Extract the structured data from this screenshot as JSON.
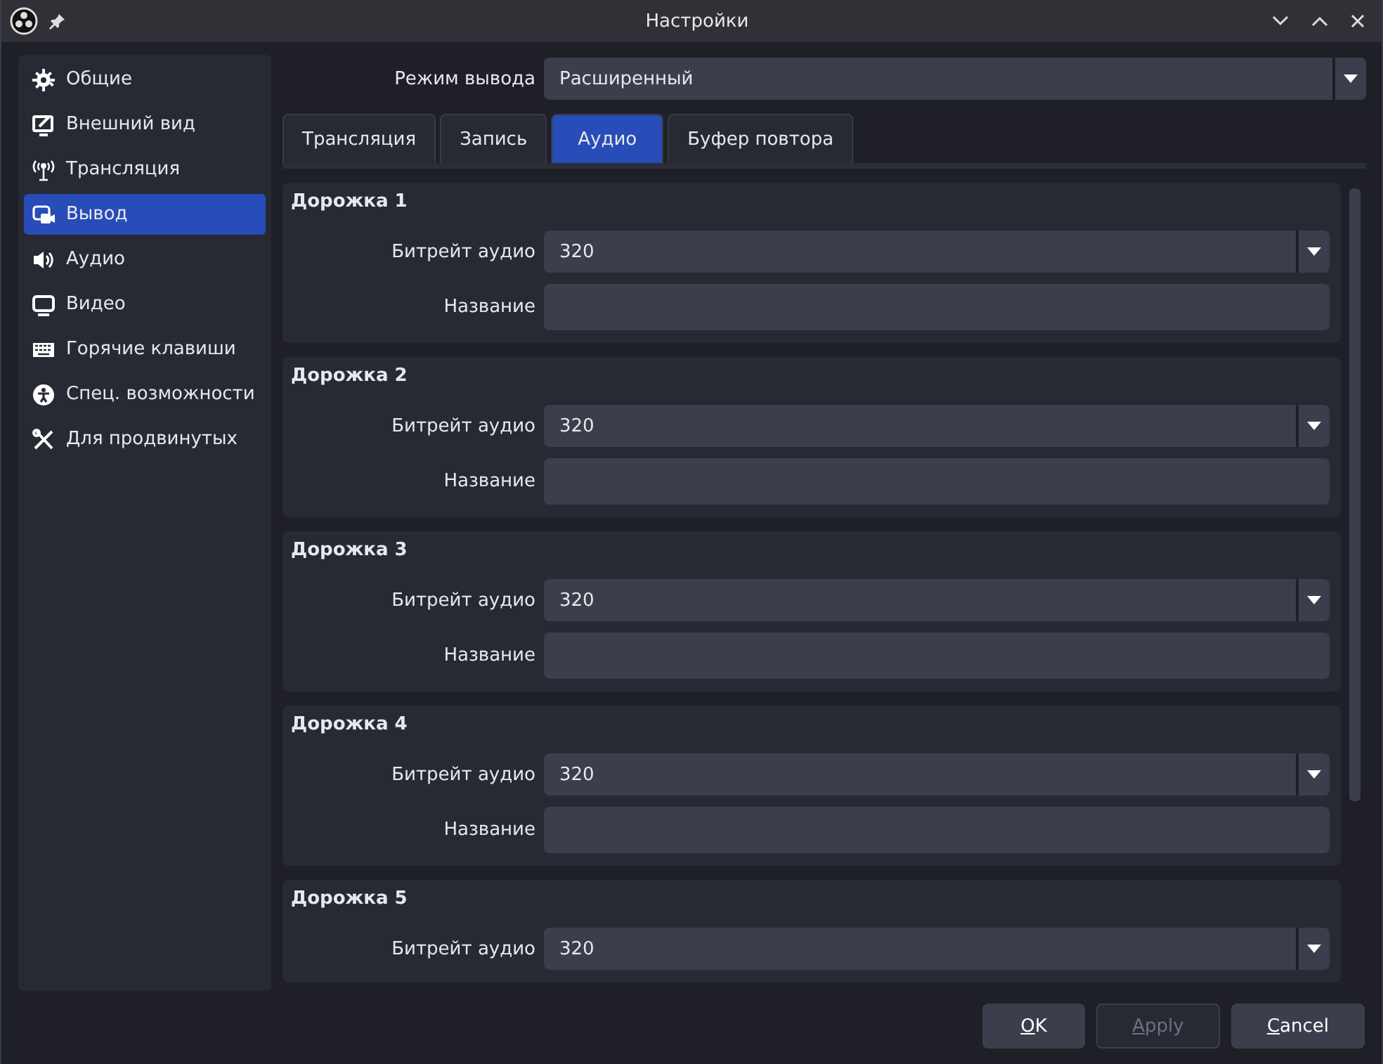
{
  "window": {
    "title": "Настройки"
  },
  "sidebar": {
    "items": [
      {
        "label": "Общие",
        "selected": false
      },
      {
        "label": "Внешний вид",
        "selected": false
      },
      {
        "label": "Трансляция",
        "selected": false
      },
      {
        "label": "Вывод",
        "selected": true
      },
      {
        "label": "Аудио",
        "selected": false
      },
      {
        "label": "Видео",
        "selected": false
      },
      {
        "label": "Горячие клавиши",
        "selected": false
      },
      {
        "label": "Спец. возможности",
        "selected": false
      },
      {
        "label": "Для продвинутых",
        "selected": false
      }
    ]
  },
  "output_mode": {
    "label": "Режим вывода",
    "value": "Расширенный"
  },
  "tabs": [
    {
      "label": "Трансляция",
      "selected": false
    },
    {
      "label": "Запись",
      "selected": false
    },
    {
      "label": "Аудио",
      "selected": true
    },
    {
      "label": "Буфер повтора",
      "selected": false
    }
  ],
  "tracks": [
    {
      "title": "Дорожка 1",
      "bitrate_label": "Битрейт аудио",
      "bitrate": "320",
      "name_label": "Название"
    },
    {
      "title": "Дорожка 2",
      "bitrate_label": "Битрейт аудио",
      "bitrate": "320",
      "name_label": "Название"
    },
    {
      "title": "Дорожка 3",
      "bitrate_label": "Битрейт аудио",
      "bitrate": "320",
      "name_label": "Название"
    },
    {
      "title": "Дорожка 4",
      "bitrate_label": "Битрейт аудио",
      "bitrate": "320",
      "name_label": "Название"
    },
    {
      "title": "Дорожка 5",
      "bitrate_label": "Битрейт аудио",
      "bitrate": "320"
    }
  ],
  "buttons": [
    {
      "label": "OK",
      "disabled": false
    },
    {
      "label": "Apply",
      "disabled": true
    },
    {
      "label": "Cancel",
      "disabled": false
    }
  ]
}
